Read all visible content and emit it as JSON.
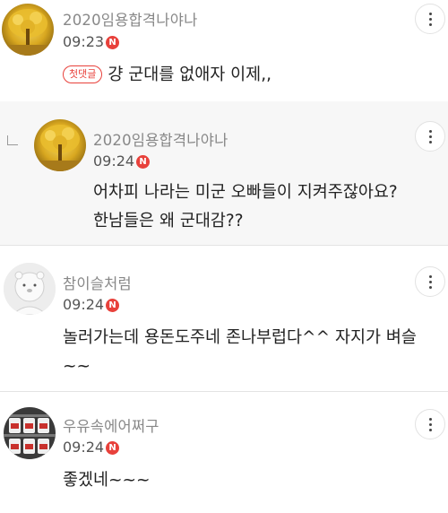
{
  "comments": [
    {
      "author": "2020임용합격나야나",
      "time": "09:23",
      "new_badge": "N",
      "first_badge": "첫댓글",
      "lines": [
        "걍 군대를 없애자 이제,,"
      ]
    },
    {
      "author": "2020임용합격나야나",
      "time": "09:24",
      "new_badge": "N",
      "lines": [
        "어차피 나라는 미군 오빠들이 지켜주잖아요?",
        "한남들은 왜 군대감??"
      ]
    },
    {
      "author": "참이슬처럼",
      "time": "09:24",
      "new_badge": "N",
      "lines": [
        "놀러가는데 용돈도주네 존나부럽다^^ 자지가 벼슬",
        "~~"
      ]
    },
    {
      "author": "우유속에어쩌구",
      "time": "09:24",
      "new_badge": "N",
      "lines": [
        "좋겠네~~~"
      ]
    }
  ],
  "colors": {
    "accent": "#e8413b",
    "author_text": "#888888",
    "reply_background": "#f7f7f7"
  },
  "icons": {
    "more": "more-vertical-icon",
    "reply": "reply-arrow-icon",
    "new": "new-badge-icon"
  }
}
